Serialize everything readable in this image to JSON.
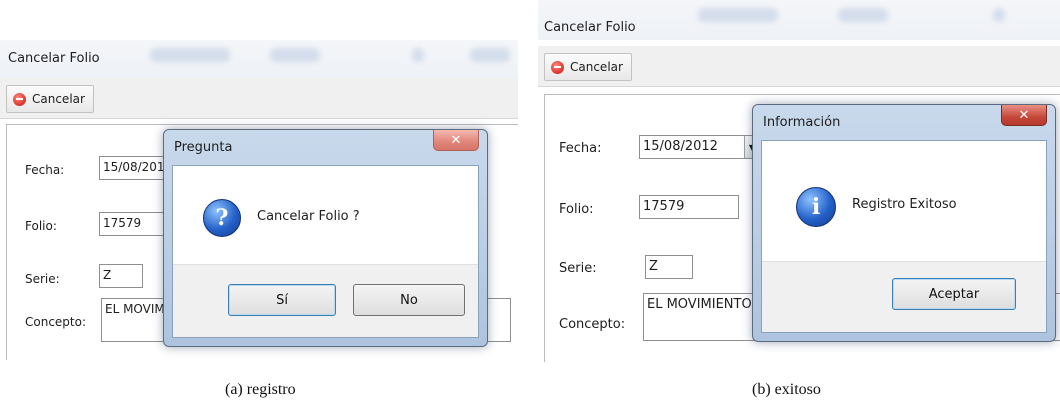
{
  "panels": {
    "a": {
      "window_title": "Cancelar Folio",
      "toolbar_button": "Cancelar",
      "form": {
        "fecha_label": "Fecha:",
        "fecha_value": "15/08/2012",
        "folio_label": "Folio:",
        "folio_value": "17579",
        "serie_label": "Serie:",
        "serie_value": "Z",
        "concepto_label": "Concepto:",
        "concepto_value": "EL MOVIMIENTO"
      },
      "dialog": {
        "title": "Pregunta",
        "close": "✕",
        "icon": "question-icon",
        "message": "Cancelar Folio ?",
        "buttons": [
          "Sí",
          "No"
        ]
      },
      "caption": "(a)  registro"
    },
    "b": {
      "window_title": "Cancelar Folio",
      "toolbar_button": "Cancelar",
      "form": {
        "fecha_label": "Fecha:",
        "fecha_value": "15/08/2012",
        "folio_label": "Folio:",
        "folio_value": "17579",
        "serie_label": "Serie:",
        "serie_value": "Z",
        "concepto_label": "Concepto:",
        "concepto_value": "EL MOVIMIENTO"
      },
      "dialog": {
        "title": "Información",
        "close": "✕",
        "icon": "info-icon",
        "message": "Registro Exitoso",
        "buttons": [
          "Aceptar"
        ]
      },
      "caption": "(b)  exitoso"
    }
  },
  "colors": {
    "dialog_frame": "#aec4de",
    "close_button": "#c5483a",
    "icon_blue": "#2461c8"
  }
}
